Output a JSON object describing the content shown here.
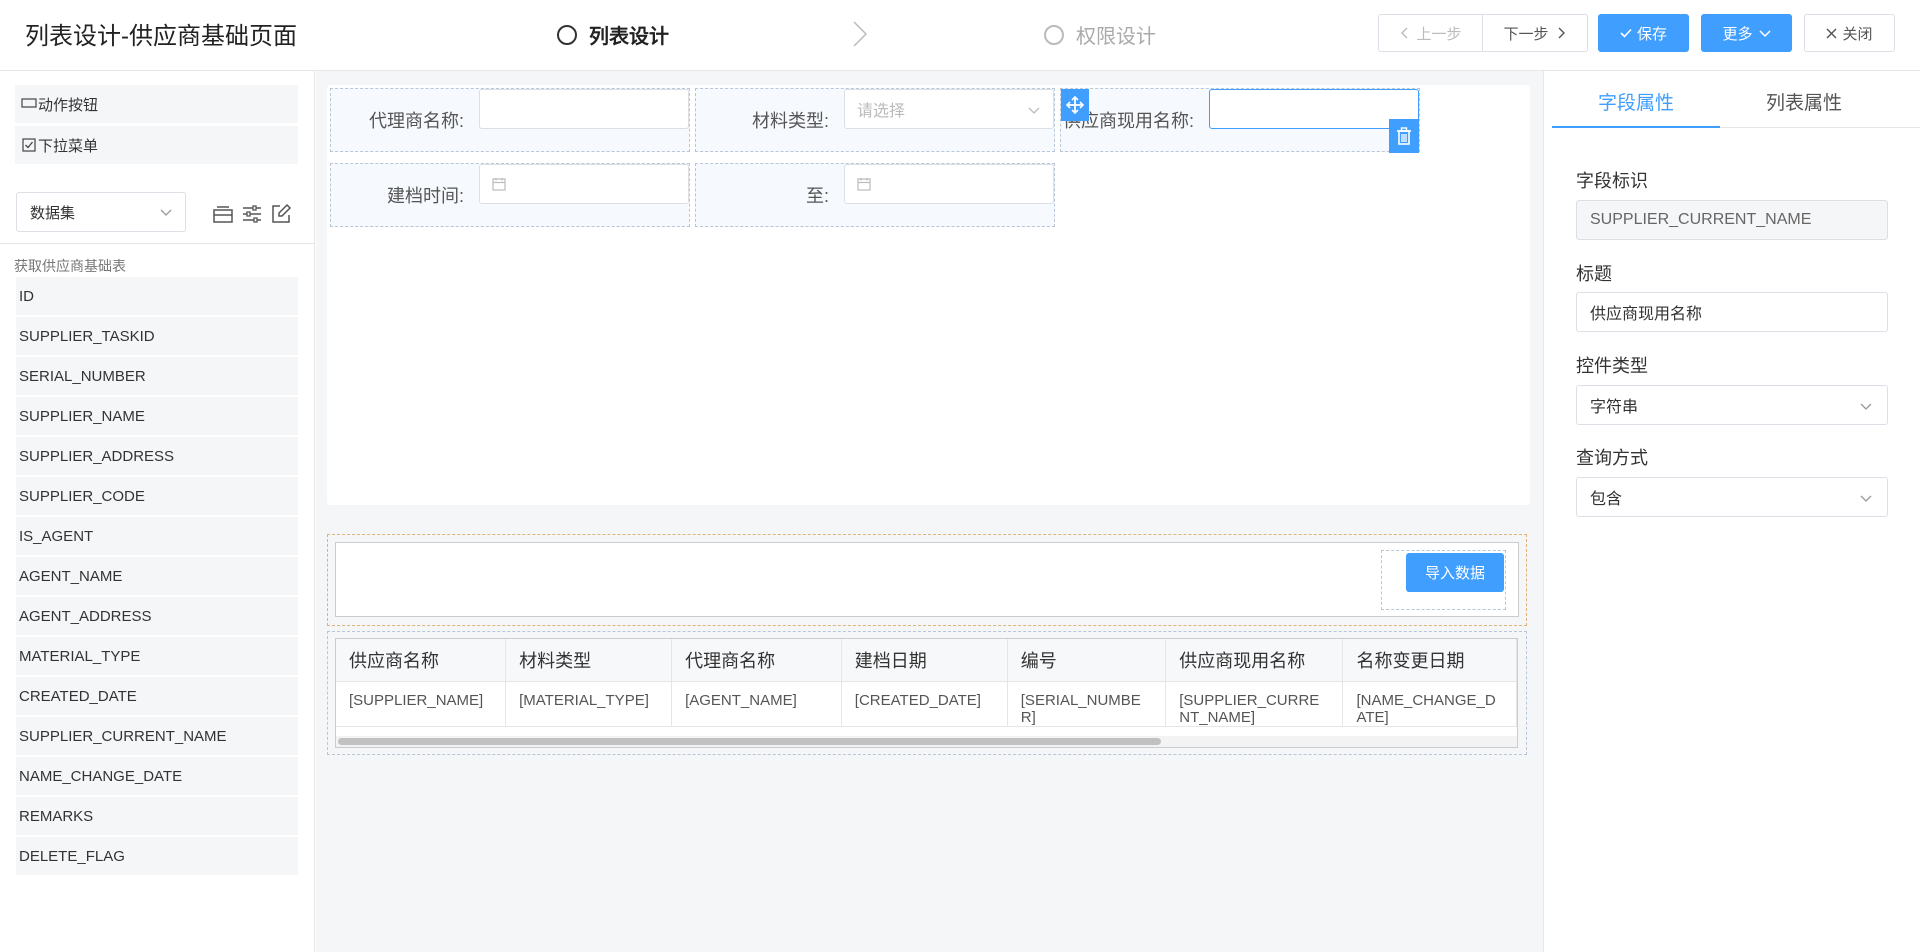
{
  "header": {
    "title": "列表设计-供应商基础页面",
    "steps": [
      {
        "label": "列表设计",
        "active": true
      },
      {
        "label": "权限设计",
        "active": false
      }
    ],
    "buttons": {
      "prev": "上一步",
      "next": "下一步",
      "save": "保存",
      "more": "更多",
      "close": "关闭"
    }
  },
  "left": {
    "tools": [
      {
        "label": "动作按钮",
        "icon": "button-icon"
      },
      {
        "label": "下拉菜单",
        "icon": "checkbox-icon"
      }
    ],
    "dataset_select": "数据集",
    "dataset_label": "获取供应商基础表",
    "fields": [
      "ID",
      "SUPPLIER_TASKID",
      "SERIAL_NUMBER",
      "SUPPLIER_NAME",
      "SUPPLIER_ADDRESS",
      "SUPPLIER_CODE",
      "IS_AGENT",
      "AGENT_NAME",
      "AGENT_ADDRESS",
      "MATERIAL_TYPE",
      "CREATED_DATE",
      "SUPPLIER_CURRENT_NAME",
      "NAME_CHANGE_DATE",
      "REMARKS",
      "DELETE_FLAG"
    ]
  },
  "form": {
    "agent_name_label": "代理商名称:",
    "material_type_label": "材料类型:",
    "material_type_placeholder": "请选择",
    "current_name_label": "供应商现用名称:",
    "created_time_label": "建档时间:",
    "to_label": "至:"
  },
  "table": {
    "import_button": "导入数据",
    "columns": [
      "供应商名称",
      "材料类型",
      "代理商名称",
      "建档日期",
      "编号",
      "供应商现用名称",
      "名称变更日期"
    ],
    "row": [
      "[SUPPLIER_NAME]",
      "[MATERIAL_TYPE]",
      "[AGENT_NAME]",
      "[CREATED_DATE]",
      "[SERIAL_NUMBER]",
      "[SUPPLIER_CURRENT_NAME]",
      "[NAME_CHANGE_DATE]"
    ]
  },
  "right": {
    "tabs": [
      "字段属性",
      "列表属性"
    ],
    "field_id_label": "字段标识",
    "field_id_value": "SUPPLIER_CURRENT_NAME",
    "title_label": "标题",
    "title_value": "供应商现用名称",
    "control_type_label": "控件类型",
    "control_type_value": "字符串",
    "query_mode_label": "查询方式",
    "query_mode_value": "包含"
  },
  "colors": {
    "accent": "#409eff",
    "border": "#dcdfe6",
    "panel_bg": "#f5f6f7"
  }
}
